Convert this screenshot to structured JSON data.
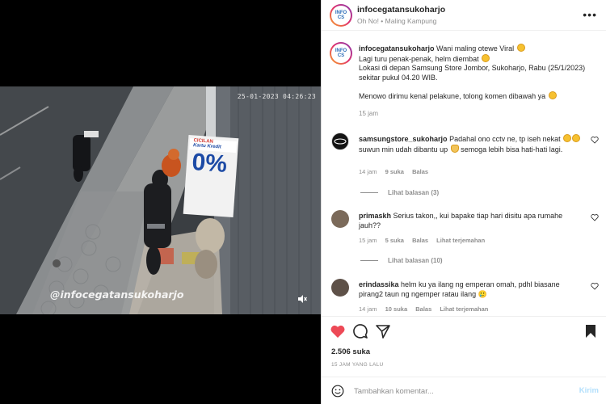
{
  "video": {
    "timestamp": "25-01-2023 04:26:23",
    "watermark": "@infocegatansukoharjo",
    "poster_text_1": "CICILAN",
    "poster_text_2": "Kartu Kredit",
    "poster_text_3": "0%",
    "mute_icon": "speaker-muted-icon"
  },
  "header": {
    "username": "infocegatansukoharjo",
    "subtitle": "Oh No! • Maling Kampung",
    "avatar_text": "INFO CS",
    "more_icon": "more-icon",
    "more_label": "•••"
  },
  "caption": {
    "username": "infocegatansukoharjo",
    "line1": "Wani maling otewe Viral",
    "line2": "Lagi turu penak-penak, helm diembat",
    "line3": "Lokasi di depan Samsung Store Jombor, Sukoharjo, Rabu (25/1/2023) sekitar pukul 04.20 WIB.",
    "line4": "Menowo dirimu kenal pelakune, tolong komen dibawah ya",
    "time": "15 jam"
  },
  "comments": [
    {
      "username": "samsungstore_sukoharjo",
      "text_a": "Padahal ono cctv ne, tp iseh nekat",
      "text_b": "suwun min udah dibantu up",
      "text_c": "semoga lebih bisa hati-hati lagi.",
      "time": "14 jam",
      "likes": "9 suka",
      "reply": "Balas",
      "view_replies": "Lihat balasan (3)"
    },
    {
      "username": "primaskh",
      "text": "Serius takon,, kui bapake tiap hari disitu apa rumahe jauh??",
      "time": "15 jam",
      "likes": "5 suka",
      "reply": "Balas",
      "translate": "Lihat terjemahan",
      "view_replies": "Lihat balasan (10)"
    },
    {
      "username": "erindassika",
      "text": "helm ku ya ilang ng emperan omah, pdhl biasane pirang2 taun ng ngemper ratau ilang 🥲",
      "time": "14 jam",
      "likes": "10 suka",
      "reply": "Balas",
      "translate": "Lihat terjemahan"
    }
  ],
  "actions": {
    "likes": "2.506 suka",
    "ago": "15 JAM YANG LALU",
    "placeholder": "Tambahkan komentar...",
    "post_label": "Kirim"
  },
  "colors": {
    "like_red": "#ed4956",
    "link_blue": "#b2dffc",
    "muted_text": "#8e8e8e"
  }
}
